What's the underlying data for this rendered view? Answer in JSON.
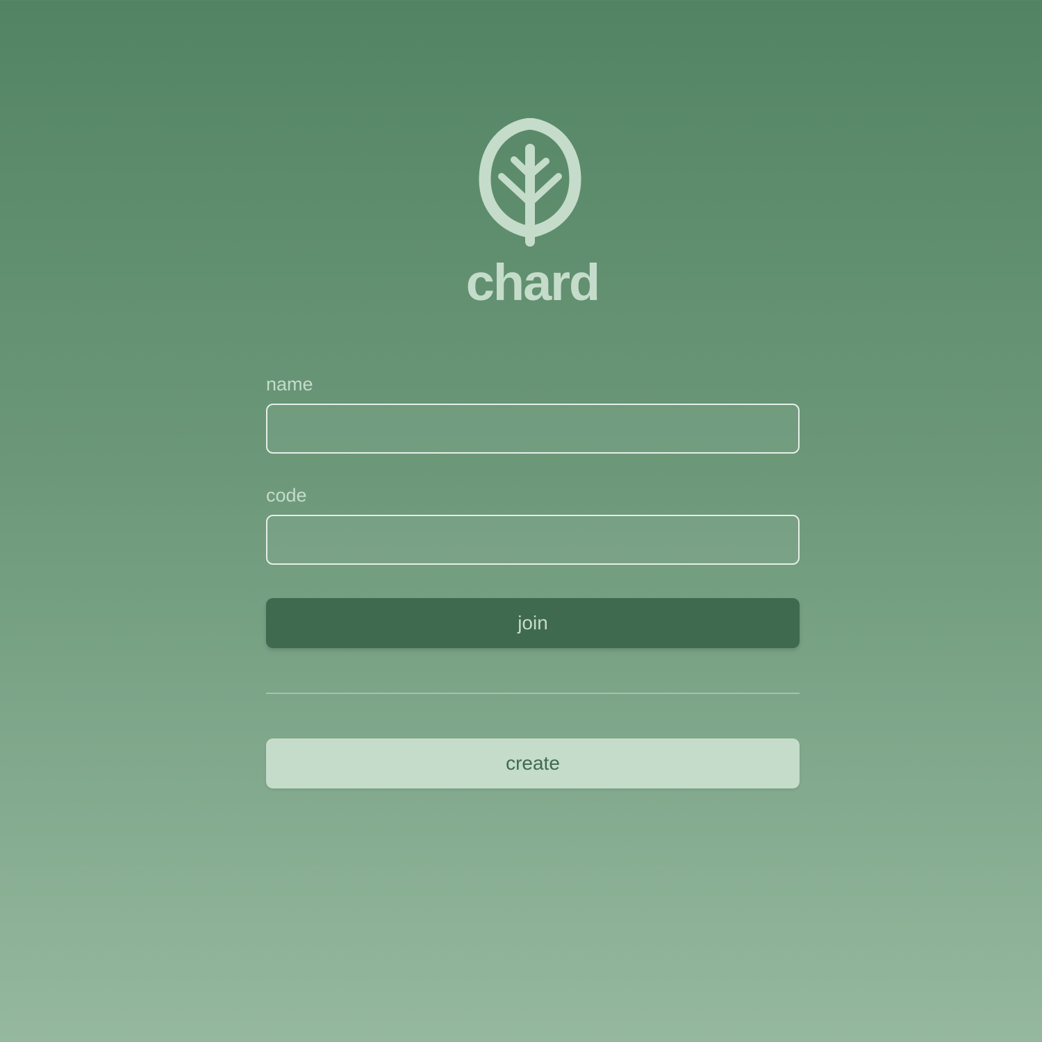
{
  "app": {
    "brand_name": "chard",
    "logo_icon": "leaf-icon"
  },
  "form": {
    "name_label": "name",
    "name_value": "",
    "name_placeholder": "",
    "code_label": "code",
    "code_value": "",
    "code_placeholder": "",
    "join_label": "join",
    "create_label": "create"
  },
  "colors": {
    "background_top": "#528463",
    "background_bottom": "#95b89e",
    "accent_light": "#c5dccb",
    "accent_dark": "#3f6a4f"
  }
}
